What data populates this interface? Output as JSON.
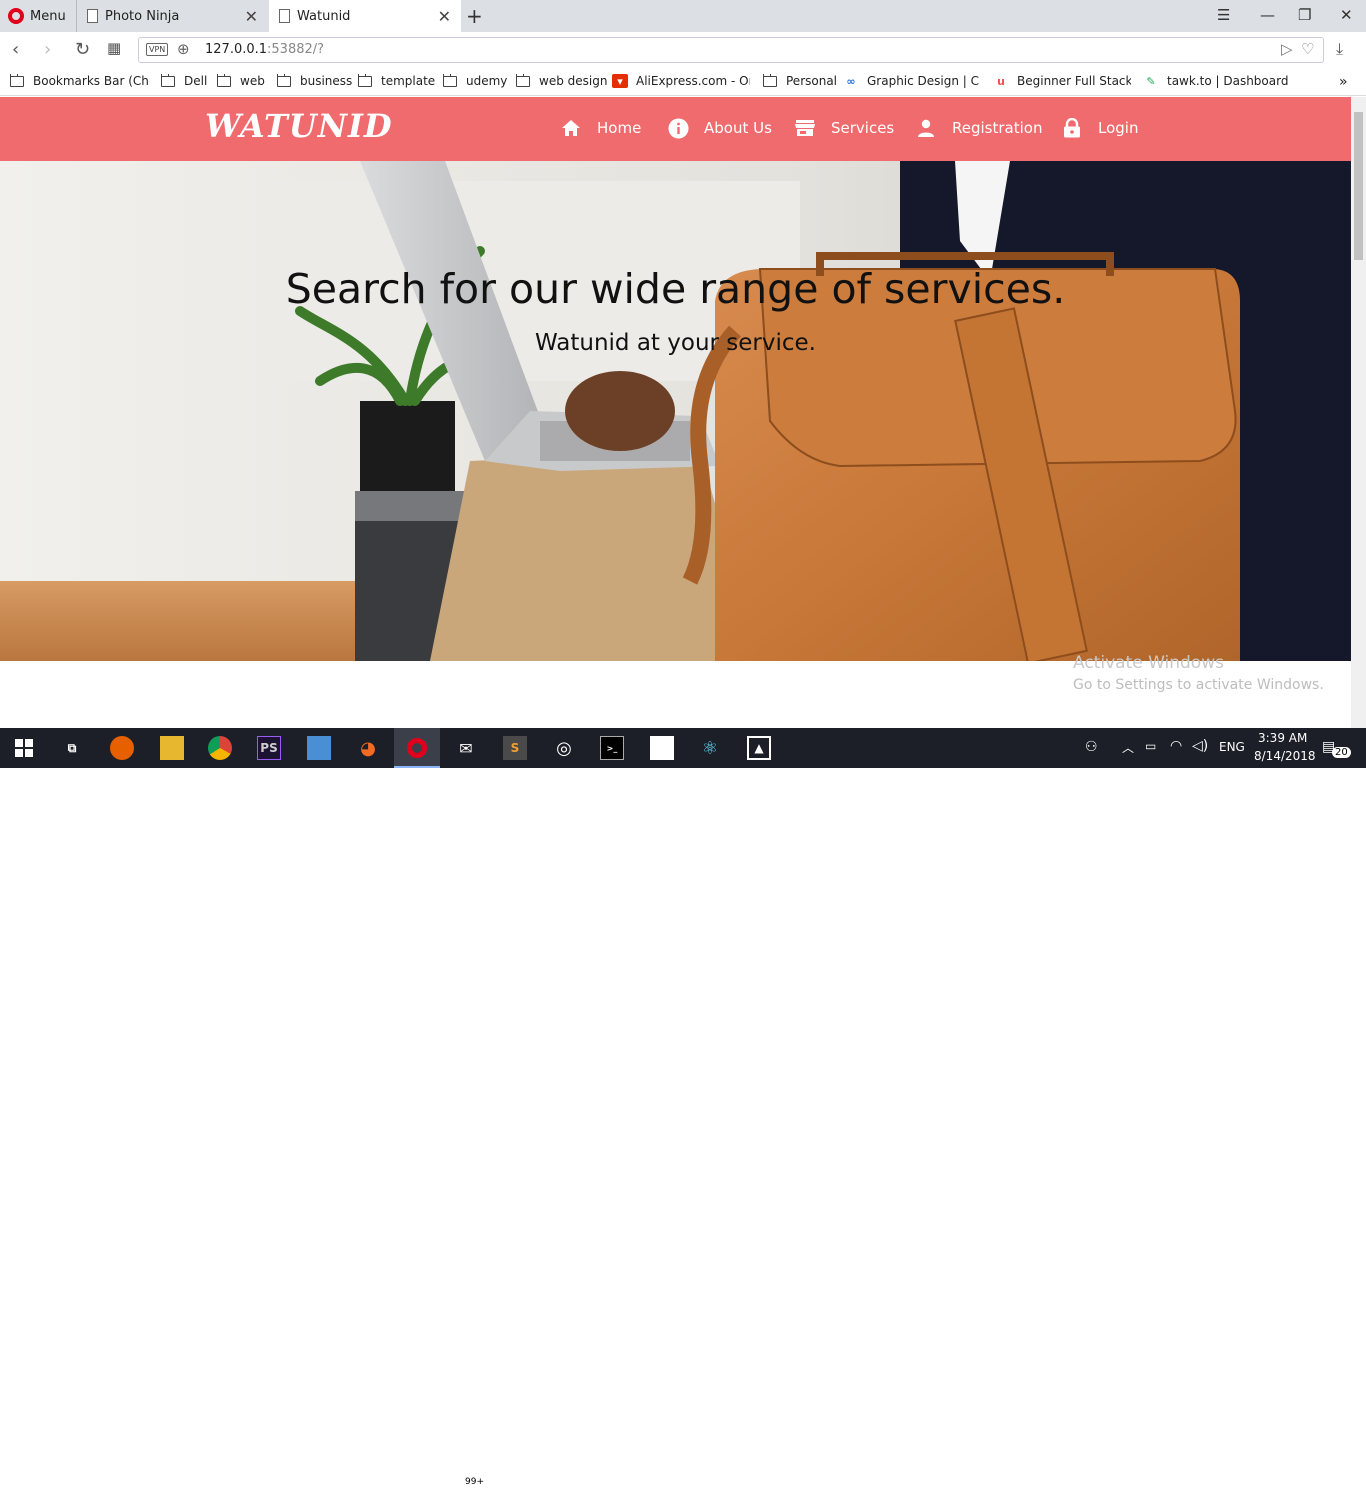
{
  "browser": {
    "menu_label": "Menu",
    "tabs": [
      {
        "title": "Photo Ninja"
      },
      {
        "title": "Watunid"
      }
    ],
    "url_host": "127.0.0.1",
    "url_rest": ":53882/?",
    "vpn_label": "VPN"
  },
  "bookmarks": [
    {
      "label": "Bookmarks Bar (Chro",
      "type": "folder"
    },
    {
      "label": "Dell",
      "type": "folder"
    },
    {
      "label": "web",
      "type": "folder"
    },
    {
      "label": "business",
      "type": "folder"
    },
    {
      "label": "template",
      "type": "folder"
    },
    {
      "label": "udemy",
      "type": "folder"
    },
    {
      "label": "web design",
      "type": "folder"
    },
    {
      "label": "AliExpress.com - Onli",
      "type": "site"
    },
    {
      "label": "Personal",
      "type": "folder"
    },
    {
      "label": "Graphic Design | Cou",
      "type": "site"
    },
    {
      "label": "Beginner Full Stack W",
      "type": "site"
    },
    {
      "label": "tawk.to | Dashboard",
      "type": "site"
    }
  ],
  "site": {
    "logo": "WATUNID",
    "brand_color": "#ef6b6e",
    "nav": [
      {
        "label": "Home",
        "icon": "home-icon"
      },
      {
        "label": "About Us",
        "icon": "info-icon"
      },
      {
        "label": "Services",
        "icon": "store-icon"
      },
      {
        "label": "Registration",
        "icon": "person-icon"
      },
      {
        "label": "Login",
        "icon": "lock-icon"
      }
    ],
    "hero": {
      "title": "Search for our wide range of services.",
      "subtitle": "Watunid at your service."
    }
  },
  "watermark": {
    "line1": "Activate Windows",
    "line2": "Go to Settings to activate Windows."
  },
  "taskbar": {
    "time": "3:39 AM",
    "date": "8/14/2018",
    "language": "ENG",
    "notif_badge": "99+",
    "notif_count": "20"
  }
}
